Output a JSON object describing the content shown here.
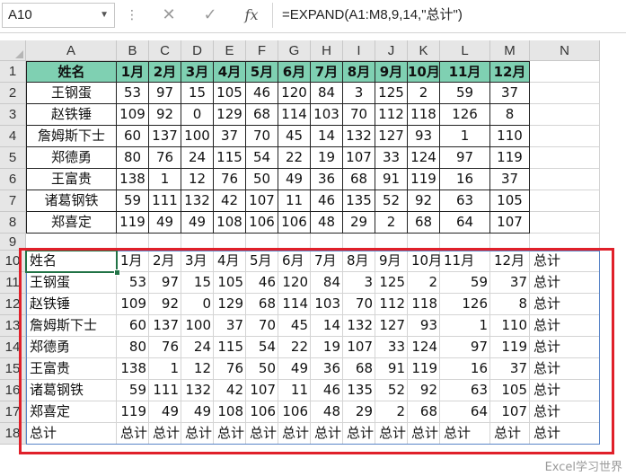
{
  "formula_bar": {
    "name_box": "A10",
    "formula": "=EXPAND(A1:M8,9,14,\"总计\")",
    "cancel_icon": "✕",
    "enter_icon": "✓",
    "fx_label": "fx"
  },
  "columns": [
    "A",
    "B",
    "C",
    "D",
    "E",
    "F",
    "G",
    "H",
    "I",
    "J",
    "K",
    "L",
    "M",
    "N"
  ],
  "rows": [
    "1",
    "2",
    "3",
    "4",
    "5",
    "6",
    "7",
    "8",
    "9",
    "10",
    "11",
    "12",
    "13",
    "14",
    "15",
    "16",
    "17",
    "18"
  ],
  "source_table": {
    "header": [
      "姓名",
      "1月",
      "2月",
      "3月",
      "4月",
      "5月",
      "6月",
      "7月",
      "8月",
      "9月",
      "10月",
      "11月",
      "12月"
    ],
    "rows": [
      [
        "王钢蛋",
        "53",
        "97",
        "15",
        "105",
        "46",
        "120",
        "84",
        "3",
        "125",
        "2",
        "59",
        "37"
      ],
      [
        "赵铁锤",
        "109",
        "92",
        "0",
        "129",
        "68",
        "114",
        "103",
        "70",
        "112",
        "118",
        "126",
        "8"
      ],
      [
        "詹姆斯下士",
        "60",
        "137",
        "100",
        "37",
        "70",
        "45",
        "14",
        "132",
        "127",
        "93",
        "1",
        "110"
      ],
      [
        "郑德勇",
        "80",
        "76",
        "24",
        "115",
        "54",
        "22",
        "19",
        "107",
        "33",
        "124",
        "97",
        "119"
      ],
      [
        "王富贵",
        "138",
        "1",
        "12",
        "76",
        "50",
        "49",
        "36",
        "68",
        "91",
        "119",
        "16",
        "37"
      ],
      [
        "诸葛钢铁",
        "59",
        "111",
        "132",
        "42",
        "107",
        "11",
        "46",
        "135",
        "52",
        "92",
        "63",
        "105"
      ],
      [
        "郑喜定",
        "119",
        "49",
        "49",
        "108",
        "106",
        "106",
        "48",
        "29",
        "2",
        "68",
        "64",
        "107"
      ]
    ]
  },
  "expanded_table": {
    "rows": [
      [
        "姓名",
        "1月",
        "2月",
        "3月",
        "4月",
        "5月",
        "6月",
        "7月",
        "8月",
        "9月",
        "10月",
        "11月",
        "12月",
        "总计"
      ],
      [
        "王钢蛋",
        "53",
        "97",
        "15",
        "105",
        "46",
        "120",
        "84",
        "3",
        "125",
        "2",
        "59",
        "37",
        "总计"
      ],
      [
        "赵铁锤",
        "109",
        "92",
        "0",
        "129",
        "68",
        "114",
        "103",
        "70",
        "112",
        "118",
        "126",
        "8",
        "总计"
      ],
      [
        "詹姆斯下士",
        "60",
        "137",
        "100",
        "37",
        "70",
        "45",
        "14",
        "132",
        "127",
        "93",
        "1",
        "110",
        "总计"
      ],
      [
        "郑德勇",
        "80",
        "76",
        "24",
        "115",
        "54",
        "22",
        "19",
        "107",
        "33",
        "124",
        "97",
        "119",
        "总计"
      ],
      [
        "王富贵",
        "138",
        "1",
        "12",
        "76",
        "50",
        "49",
        "36",
        "68",
        "91",
        "119",
        "16",
        "37",
        "总计"
      ],
      [
        "诸葛钢铁",
        "59",
        "111",
        "132",
        "42",
        "107",
        "11",
        "46",
        "135",
        "52",
        "92",
        "63",
        "105",
        "总计"
      ],
      [
        "郑喜定",
        "119",
        "49",
        "49",
        "108",
        "106",
        "106",
        "48",
        "29",
        "2",
        "68",
        "64",
        "107",
        "总计"
      ],
      [
        "总计",
        "总计",
        "总计",
        "总计",
        "总计",
        "总计",
        "总计",
        "总计",
        "总计",
        "总计",
        "总计",
        "总计",
        "总计",
        "总计"
      ]
    ]
  },
  "watermark": "Excel学习世界",
  "colors": {
    "header_fill": "#7fd0b2",
    "highlight_border": "#e0202a",
    "selection": "#217346",
    "spill_border": "#5a85c8"
  }
}
